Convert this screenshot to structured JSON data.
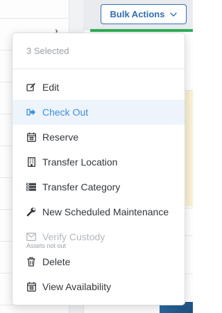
{
  "toolbar": {
    "bulk_actions_label": "Bulk Actions"
  },
  "menu": {
    "header": "3 Selected",
    "items": [
      {
        "label": "Edit",
        "icon": "edit-icon"
      },
      {
        "label": "Check Out",
        "icon": "check-out-icon",
        "active": true
      },
      {
        "label": "Reserve",
        "icon": "calendar-icon"
      },
      {
        "label": "Transfer Location",
        "icon": "building-icon"
      },
      {
        "label": "Transfer Category",
        "icon": "category-icon"
      },
      {
        "label": "New Scheduled Maintenance",
        "icon": "wrench-icon"
      },
      {
        "label": "Verify Custody",
        "icon": "envelope-check-icon",
        "disabled": true,
        "sublabel": "Assets not out"
      },
      {
        "label": "Delete",
        "icon": "trash-icon"
      },
      {
        "label": "View Availability",
        "icon": "calendar-icon"
      }
    ]
  },
  "colors": {
    "accent": "#2f6db3",
    "active_text": "#3b8fdd",
    "active_bg": "#eef4fb",
    "status_green": "#2eae58"
  }
}
